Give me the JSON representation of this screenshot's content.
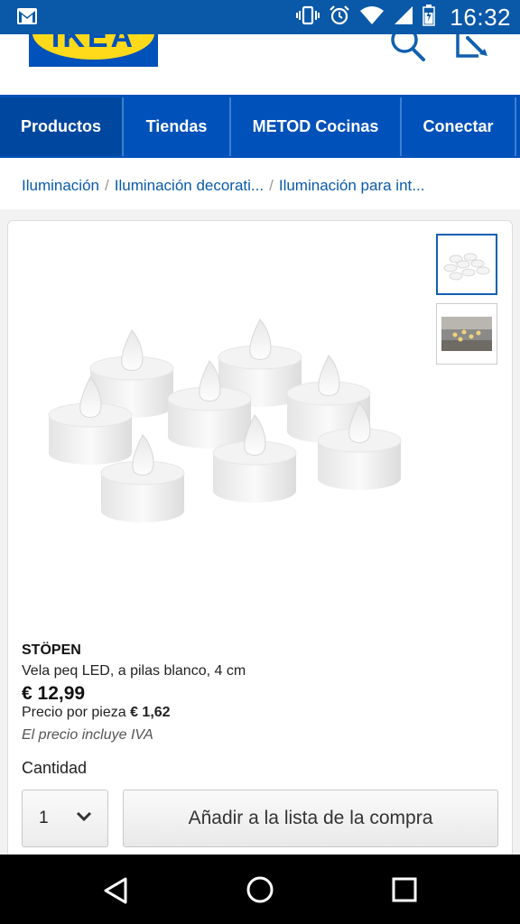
{
  "status_bar": {
    "time": "16:32",
    "icons": [
      "gmail-icon",
      "vibrate-icon",
      "alarm-icon",
      "wifi-icon",
      "signal-icon",
      "battery-icon"
    ]
  },
  "header": {
    "logo_text": "IKEA",
    "icons": [
      "search-icon",
      "shopping-list-icon"
    ]
  },
  "nav": {
    "items": [
      {
        "label": "Productos"
      },
      {
        "label": "Tiendas"
      },
      {
        "label": "METOD Cocinas"
      },
      {
        "label": "Conectar"
      }
    ]
  },
  "breadcrumb": {
    "items": [
      {
        "label": "Iluminación"
      },
      {
        "label": "Iluminación decorati..."
      },
      {
        "label": "Iluminación para int..."
      }
    ],
    "separator": "/"
  },
  "product": {
    "name": "STÖPEN",
    "description": "Vela peq LED, a pilas blanco, 4 cm",
    "price": "€ 12,99",
    "unit_price_label": "Precio por pieza",
    "unit_price_value": "€ 1,62",
    "vat_note": "El precio incluye IVA"
  },
  "quantity": {
    "label": "Cantidad",
    "value": "1"
  },
  "actions": {
    "add_to_list": "Añadir a la lista de la compra"
  },
  "colors": {
    "brand_blue": "#0051ba",
    "brand_yellow": "#ffda1a",
    "status_bar": "#0a58a8",
    "link": "#0a5aa8"
  }
}
